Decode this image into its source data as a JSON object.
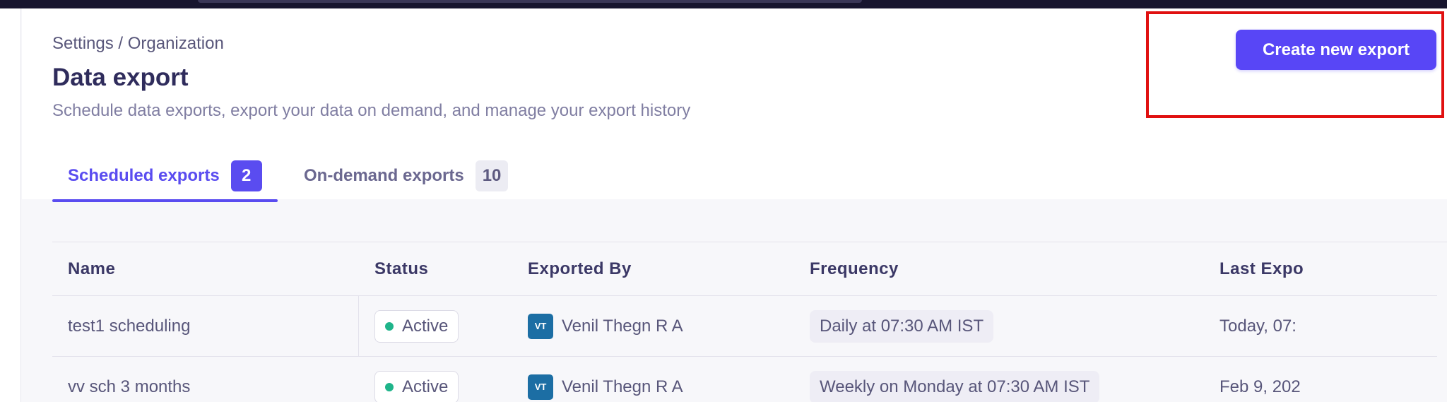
{
  "colors": {
    "accent": "#5846f6",
    "status_active": "#1fb48a",
    "avatar_bg": "#1c6ea4",
    "highlight": "#e01010"
  },
  "header": {
    "breadcrumb": "Settings / Organization",
    "title": "Data export",
    "subtitle": "Schedule data exports, export your data on demand, and manage your export history",
    "create_button_label": "Create new export"
  },
  "tabs": [
    {
      "label": "Scheduled exports",
      "count": "2",
      "selected": true
    },
    {
      "label": "On-demand exports",
      "count": "10",
      "selected": false
    }
  ],
  "table": {
    "columns": [
      "Name",
      "Status",
      "Exported By",
      "Frequency",
      "Last Expo"
    ],
    "rows": [
      {
        "name": "test1 scheduling",
        "status": "Active",
        "avatar": "VT",
        "exported_by": "Venil Thegn R A",
        "frequency": "Daily at 07:30 AM IST",
        "last_export": "Today, 07:"
      },
      {
        "name": "vv sch 3 months",
        "status": "Active",
        "avatar": "VT",
        "exported_by": "Venil Thegn R A",
        "frequency": "Weekly on Monday at 07:30 AM IST",
        "last_export": "Feb 9, 202"
      }
    ]
  }
}
